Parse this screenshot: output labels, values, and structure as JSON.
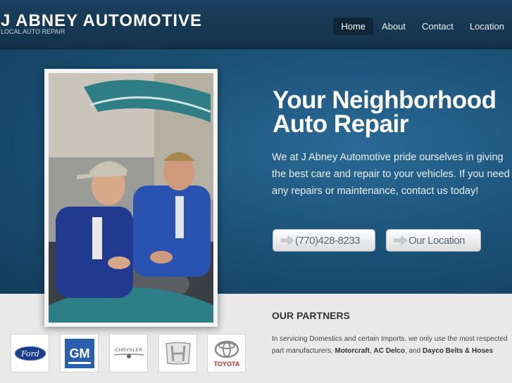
{
  "brand": {
    "title": "J ABNEY AUTOMOTIVE",
    "subtitle": "LOCAL AUTO REPAIR"
  },
  "nav": [
    {
      "label": "Home",
      "active": true
    },
    {
      "label": "About",
      "active": false
    },
    {
      "label": "Contact",
      "active": false
    },
    {
      "label": "Location",
      "active": false
    }
  ],
  "hero": {
    "title": "Your Neighborhood Auto Repair",
    "text": "We at J Abney Automotive pride ourselves in giving the best care and repair to your vehicles. If you need any repairs or maintenance, contact us today!",
    "phone_button": "(770)428-8233",
    "location_button": "Our Location"
  },
  "partners": {
    "title": "OUR PARTNERS",
    "text_before": "In servicing Domestics and certain Imports, we only use the most respected part manufacturers,",
    "brand1": "Motorcraft",
    "sep1": ",",
    "brand2": "AC Delco",
    "sep2": ", and",
    "brand3": "Dayco Belts & Hoses",
    "logos": [
      "Ford",
      "GM",
      "CHRYSLER",
      "Honda",
      "TOYOTA"
    ]
  },
  "colors": {
    "header_bg": "#1a3f5e",
    "hero_bg": "#1c5379",
    "section_bg": "#e9e9e9"
  }
}
